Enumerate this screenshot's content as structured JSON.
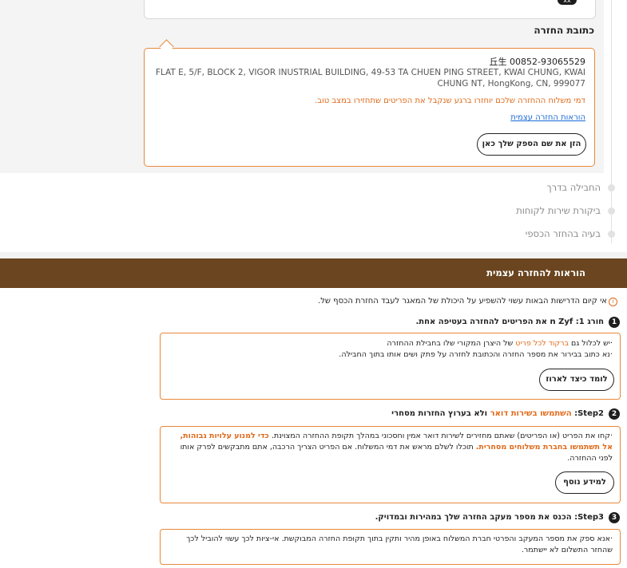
{
  "top_badge": "xx",
  "return_address": {
    "title": "כתובת החזרה",
    "name_phone": "丘生 00852-93065529",
    "address": "FLAT E, 5/F, BLOCK 2, VIGOR INUSTRIAL BUILDING, 49-53 TA CHUEN PING STREET, KWAI CHUNG, KWAI CHUNG NT, HongKong, CN, 999077",
    "shipping_note": "דמי משלוח ההחזרה שלכם יוחזרו ברגע שנקבל את הפריטים שתחזירו במצב טוב.",
    "instructions_link": "הוראות החזרה עצמית",
    "carrier_button": "הזן את שם הספק שלך כאן"
  },
  "timeline": [
    "החבילה בדרך",
    "ביקורת שירות לקוחות",
    "בעיה בהחזר הכספי"
  ],
  "self_return": {
    "title": "הוראות להחזרה עצמית",
    "warning": "אי קיום הדרישות הבאות עשוי להשפיע על היכולת של המאגר לעבד החזרת הכסף של.",
    "steps": [
      {
        "num": "1",
        "title_parts": [
          "חורג 1: n Zyf את הפריטים להחזרה בעטיפה אחת."
        ],
        "body": [
          "·יש לכלול גם ",
          "ברקוד לכל פריט",
          " של היצרן המקורי שלו בחבילת ההחזרה"
        ],
        "body2": "·נא כתוב בבירור את מספר החזרה והכתובת לחזרה על פתק ושים אותו בתוך החבילה.",
        "button": "לומד כיצד לארוז"
      },
      {
        "num": "2",
        "title_a": "Step2: ",
        "title_b": "השתמשו בשירות דואר",
        "title_c": " ולא בערוץ החזרות מסחרי",
        "body_a": "·קחו את הפריט (או הפריטים) שאתם מחזירים לשירות דואר אמין וחסכוני במהלך תקופת ההחזרה המצוינת. ",
        "body_b": "כדי למנוע עלויות גבוהות, אל תשתמשו בחברת משלוחים מסחרית.",
        "body_c": " תוכלו לשלם מראש את דמי המשלוח. אם הפריט הצריך הרכבה, אתם מתבקשים לפרק אותו לפני ההחזרה.",
        "button": "למידע נוסף"
      },
      {
        "num": "3",
        "title": "Step3: הכנס את מספר מעקב החזרה שלך במהירות ובמדויק.",
        "body": "·אנא ספק את מספר המעקב והפרטי חברת המשלוח באופן מהיר ותקין בתוך תקופת החזרה המבוקשת. אי-ציות לכך עשוי להוביל לכך שהחזר התשלום לא יישתמר."
      }
    ]
  },
  "colors": {
    "accent": "#e8883a",
    "banner": "#6a4520",
    "link": "#1a6bd6"
  }
}
